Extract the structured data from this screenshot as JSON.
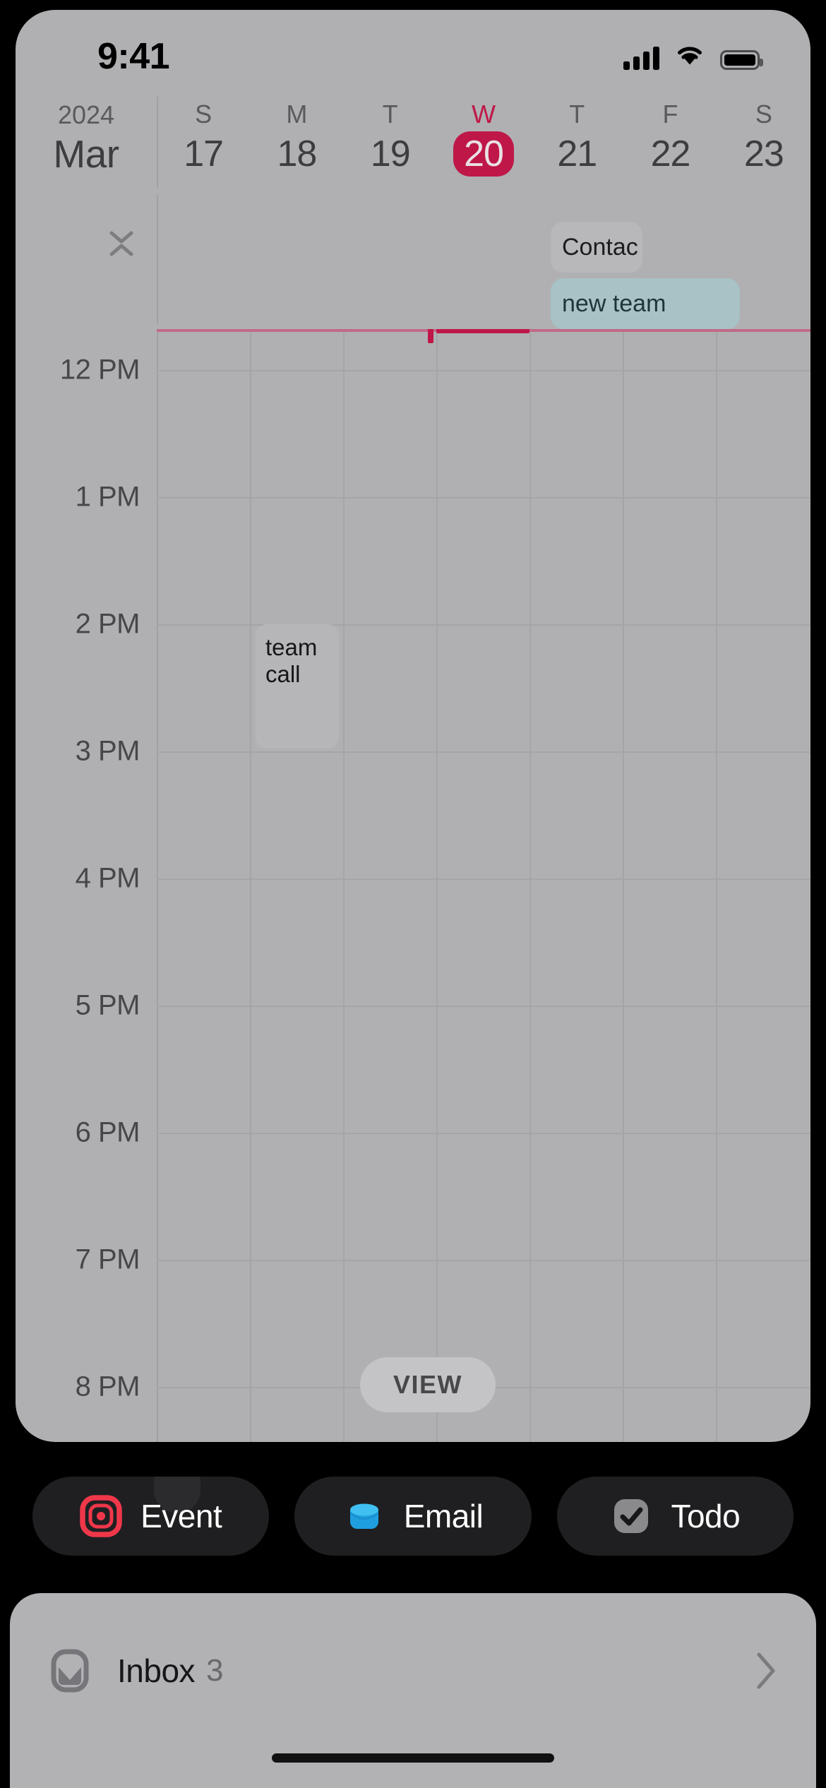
{
  "status_bar": {
    "time": "9:41",
    "icons": [
      "cellular-signal-icon",
      "wifi-icon",
      "battery-icon"
    ]
  },
  "calendar": {
    "year": "2024",
    "month": "Mar",
    "collapse_icon": "collapse-chevrons-icon",
    "days": [
      {
        "dow": "S",
        "date": "17",
        "today": false
      },
      {
        "dow": "M",
        "date": "18",
        "today": false
      },
      {
        "dow": "T",
        "date": "19",
        "today": false
      },
      {
        "dow": "W",
        "date": "20",
        "today": true
      },
      {
        "dow": "T",
        "date": "21",
        "today": false
      },
      {
        "dow": "F",
        "date": "22",
        "today": false
      },
      {
        "dow": "S",
        "date": "23",
        "today": false
      }
    ],
    "all_day_events": [
      {
        "title": "Contac",
        "day": "21",
        "color": "#b8b8bb"
      },
      {
        "title": "new team",
        "day": "21",
        "color": "#a8c2c6"
      }
    ],
    "time_labels": [
      "12 PM",
      "1 PM",
      "2 PM",
      "3 PM",
      "4 PM",
      "5 PM",
      "6 PM",
      "7 PM",
      "8 PM"
    ],
    "events": [
      {
        "title": "team call",
        "day": "18",
        "start": "2 PM",
        "end": "3 PM",
        "color": "#b6b6b9"
      }
    ],
    "now_indicator": {
      "day": "20",
      "color": "#bf1848"
    },
    "view_button": "VIEW",
    "accent_color": "#bf1848"
  },
  "actions": [
    {
      "label": "Event",
      "icon": "event-record-icon",
      "color": "#f0374a"
    },
    {
      "label": "Email",
      "icon": "envelope-icon",
      "color": "#2aa8e8"
    },
    {
      "label": "Todo",
      "icon": "checkmark-square-icon",
      "color": "#8a8a8d"
    }
  ],
  "inbox": {
    "icon": "inbox-envelope-icon",
    "label": "Inbox",
    "count": "3",
    "chevron": "chevron-right-icon"
  }
}
